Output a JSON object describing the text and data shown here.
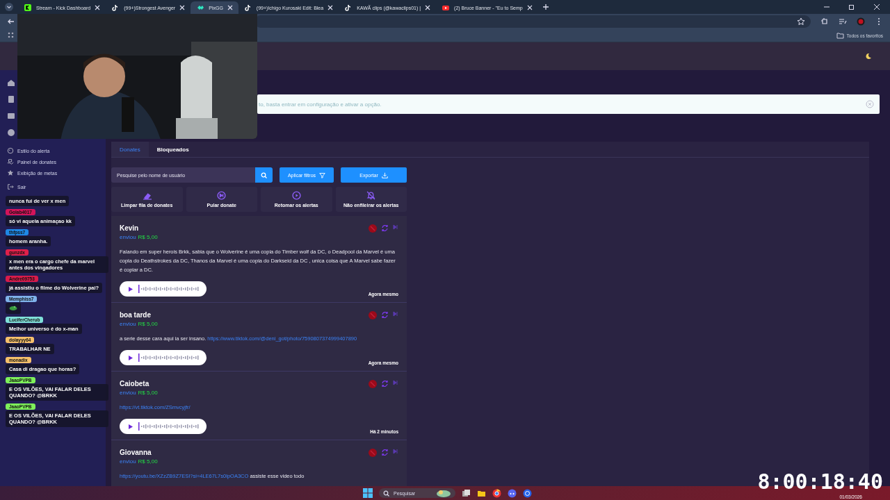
{
  "browser": {
    "tabs": [
      {
        "title": "Stream - Kick Dashboard",
        "selected": false
      },
      {
        "title": "(99+)Strongest Avenger",
        "selected": false
      },
      {
        "title": "PixGG",
        "selected": true
      },
      {
        "title": "(99+)Ichigo Kurosaki Edit: Blea",
        "selected": false
      },
      {
        "title": "KAWÃ clips (@kawaclips01) |",
        "selected": false
      },
      {
        "title": "(2) Bruce Banner - \"Eu to Semp",
        "selected": false
      }
    ],
    "bookmarks_label": "Todos os favoritos"
  },
  "sidebar": {
    "items": [
      {
        "label": "Estilo do alerta"
      },
      {
        "label": "Painel de donates"
      },
      {
        "label": "Exibição de metas"
      },
      {
        "label": "Sair"
      }
    ]
  },
  "banner": {
    "text": "to, basta entrar em configuração e ativar a opção."
  },
  "panel": {
    "tabs": [
      {
        "label": "Donates",
        "selected": true
      },
      {
        "label": "Bloqueados",
        "selected": false
      }
    ],
    "search": {
      "placeholder": "Pesquise pelo nome de usuário"
    },
    "buttons": [
      {
        "label": "Aplicar filtros"
      },
      {
        "label": "Exportar"
      }
    ],
    "actions": [
      {
        "label": "Limpar fila de donates"
      },
      {
        "label": "Pular donate"
      },
      {
        "label": "Retomar os alertas"
      },
      {
        "label": "Não enfileirar os alertas"
      }
    ],
    "donates": [
      {
        "name": "Kevin",
        "sent": "enviou",
        "amount": "R$ 5,00",
        "message": [
          {
            "kind": "text",
            "text": "Falando em super herois Brkk, sabia que o Wolverine é uma copia do Timber wolf da DC, o Deadpool da Marvel é uma copia do Deathstrokes da DC, Thanos da Marvel é uma copia do Darkseid da DC , unica coisa que A Marvel sabe fazer é copiar a DC."
          }
        ],
        "time": "Agora mesmo"
      },
      {
        "name": "boa tarde",
        "sent": "enviou",
        "amount": "R$ 5,00",
        "message": [
          {
            "kind": "text",
            "text": "a serie desse cara aqui ia ser insano. "
          },
          {
            "kind": "link",
            "text": "https://www.tiktok.com/@deni_got/photo/7590807374999407890"
          }
        ],
        "time": "Agora mesmo"
      },
      {
        "name": "Caiobeta",
        "sent": "enviou",
        "amount": "R$ 5,00",
        "message": [
          {
            "kind": "link",
            "text": "https://vt.tiktok.com/ZSmvcyjfr/"
          }
        ],
        "time": "Há 2 minutos"
      },
      {
        "name": "Giovanna",
        "sent": "enviou",
        "amount": "R$ 5,00",
        "message": [
          {
            "kind": "link",
            "text": "https://youtu.be/XZzZB9Z7ESI?si=4LE67L7s0lpOA3CO"
          },
          {
            "kind": "text",
            "text": " assiste esse video todo"
          }
        ]
      }
    ]
  },
  "chat": {
    "messages": [
      {
        "kind": "text",
        "text": "nunca fui de ver x men"
      },
      {
        "kind": "text",
        "user": "Golab4017",
        "color": "#d4145a",
        "text": "só vi aquela animaçao kk"
      },
      {
        "kind": "text",
        "user": "thfpss7",
        "color": "#1e88e5",
        "text": "homem aranha."
      },
      {
        "kind": "text",
        "user": "gunzdx",
        "color": "#e0204a",
        "text": "x men era o cargo chefe da marvel antes dos vingadores"
      },
      {
        "kind": "text",
        "user": "Andre09753",
        "color": "#d81b4a",
        "text": "já assistiu o filme do Wolverine pai?"
      },
      {
        "kind": "emote",
        "user": "Memphiss7",
        "color": "#7fb2ea"
      },
      {
        "kind": "text",
        "user": "LuciferCherub",
        "color": "#7fe0d8",
        "text": "Melhor universo é do x-man"
      },
      {
        "kind": "text",
        "user": "dolayyy64",
        "color": "#f5c06b",
        "text": "TRABALHAR NE"
      },
      {
        "kind": "text",
        "user": "monadix",
        "color": "#f5c06b",
        "text": "Casa di dragao que horas?"
      },
      {
        "kind": "text",
        "user": "JaaoPVPB",
        "color": "#7ef05a",
        "text": "E OS VILÕES, VAI FALAR DELES QUANDO? @BRKK"
      },
      {
        "kind": "text",
        "user": "JaaoPVPB",
        "color": "#7ef05a",
        "text": "E OS VILÕES, VAI FALAR DELES QUANDO? @BRKK"
      }
    ]
  },
  "taskbar": {
    "search_placeholder": "Pesquisar",
    "date": "01/03/2026"
  },
  "timer": "8:00:18:40"
}
